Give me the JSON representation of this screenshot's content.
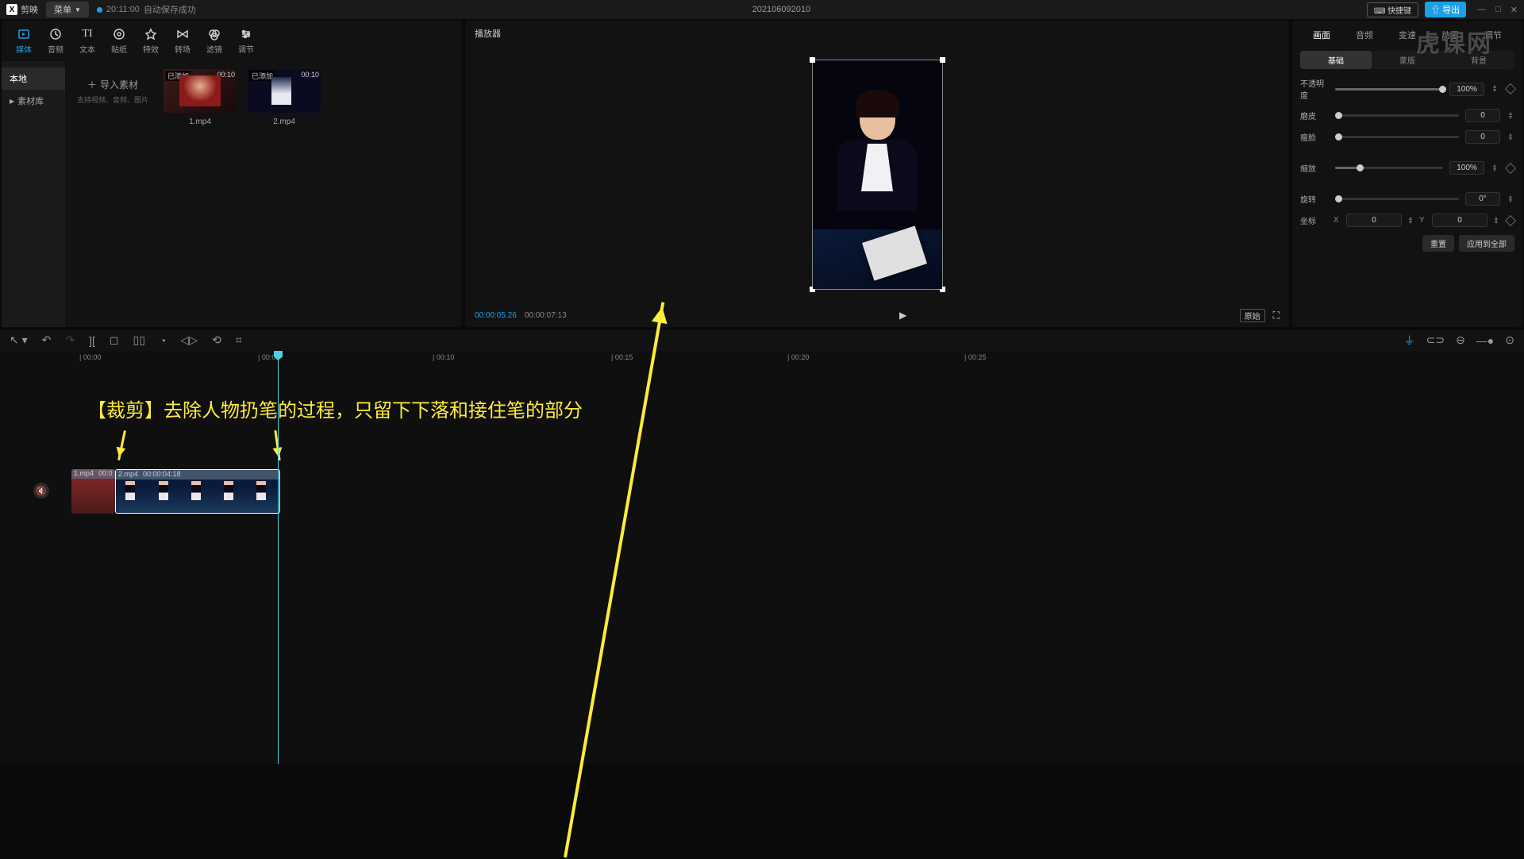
{
  "titlebar": {
    "app": "剪映",
    "menu": "菜单",
    "autosave_time": "20:11:00",
    "autosave_text": "自动保存成功",
    "project": "202106092010",
    "shortcut": "快捷键",
    "export": "导出"
  },
  "watermark": "虎课网",
  "tool_tabs": [
    {
      "label": "媒体",
      "active": true
    },
    {
      "label": "音频"
    },
    {
      "label": "文本"
    },
    {
      "label": "贴纸"
    },
    {
      "label": "特效"
    },
    {
      "label": "转场"
    },
    {
      "label": "滤镜"
    },
    {
      "label": "调节"
    }
  ],
  "left_sub": [
    {
      "label": "本地",
      "active": true
    },
    {
      "label": "素材库"
    }
  ],
  "import": {
    "label": "导入素材",
    "hint": "支持视频、音频、图片"
  },
  "clips": [
    {
      "name": "1.mp4",
      "dur": "00:10",
      "badge": "已添加"
    },
    {
      "name": "2.mp4",
      "dur": "00:10",
      "badge": "已添加"
    }
  ],
  "player": {
    "title": "播放器",
    "tc_current": "00:00:05.26",
    "tc_total": "00:00:07:13",
    "ratio": "原始"
  },
  "right": {
    "tabs": [
      "画面",
      "音频",
      "变速",
      "动画",
      "调节"
    ],
    "subtabs": [
      "基础",
      "蒙版",
      "背景"
    ],
    "props": {
      "opacity": {
        "label": "不透明度",
        "value": "100%"
      },
      "skin": {
        "label": "磨皮",
        "value": "0"
      },
      "face": {
        "label": "瘦脸",
        "value": "0"
      },
      "scale": {
        "label": "缩放",
        "value": "100%"
      },
      "rotate": {
        "label": "旋转",
        "value": "0°"
      },
      "coord": {
        "label": "坐标",
        "x": "0",
        "y": "0"
      }
    },
    "reset": "重置",
    "applyAll": "应用到全部"
  },
  "ruler": [
    "00:00",
    "00:05",
    "00:10",
    "00:15",
    "00:20",
    "00:25"
  ],
  "timeline_clips": [
    {
      "name": "1.mp4",
      "dur": "00:0"
    },
    {
      "name": "2.mp4",
      "dur": "00:00:04:18"
    }
  ],
  "annotation": "【裁剪】去除人物扔笔的过程，只留下下落和接住笔的部分"
}
